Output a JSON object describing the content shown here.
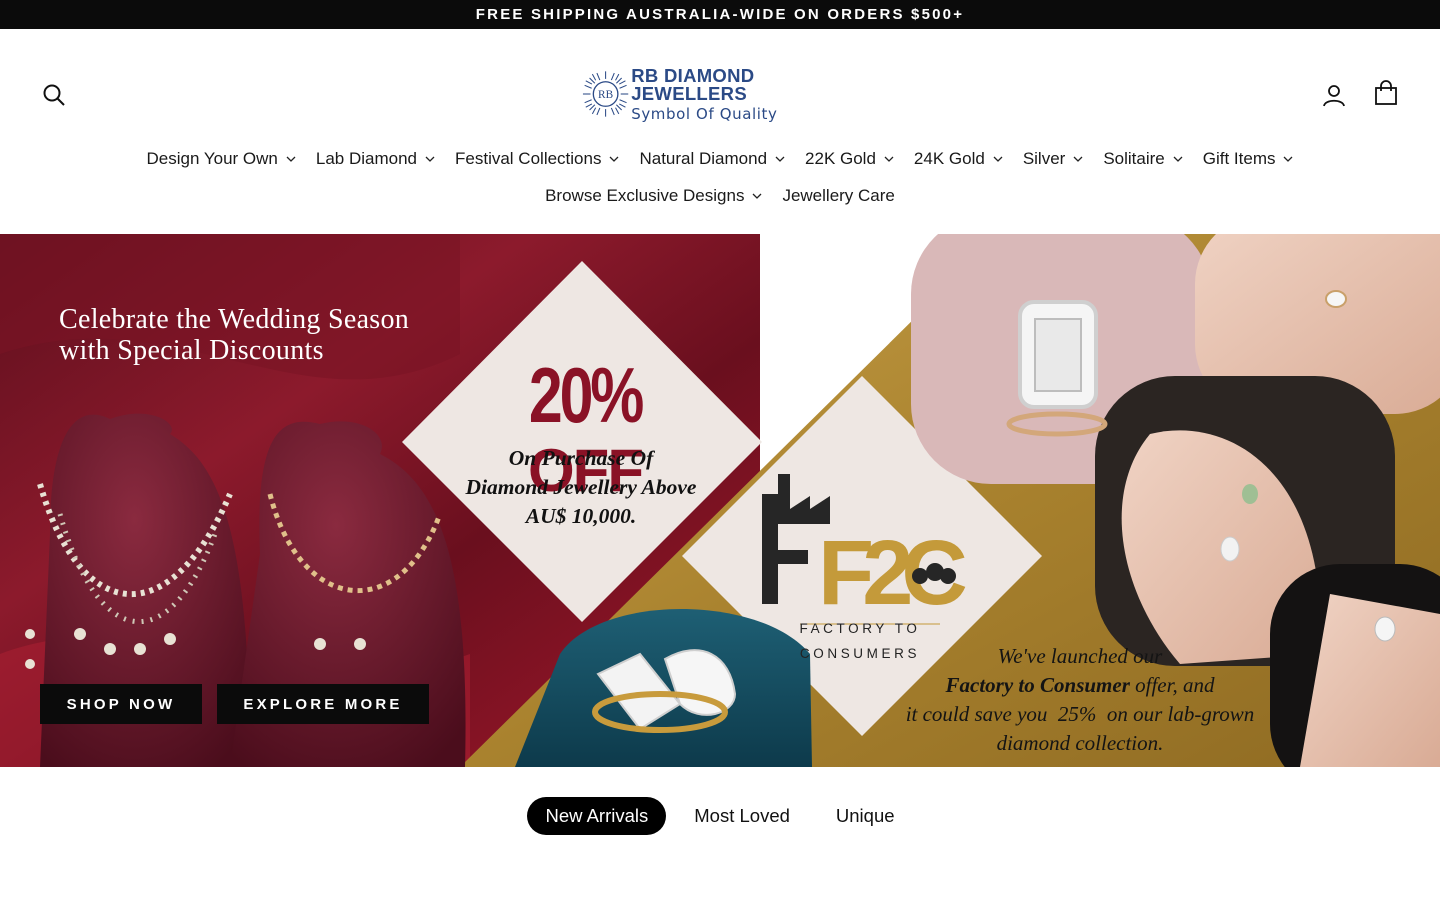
{
  "announcement": "FREE SHIPPING AUSTRALIA-WIDE ON ORDERS $500+",
  "header": {
    "logo_initials": "RB",
    "logo_name": "RB DIAMOND JEWELLERS",
    "logo_tagline": "Symbol Of Quality",
    "icons": [
      "search-icon",
      "account-icon",
      "cart-icon"
    ]
  },
  "nav": {
    "row1": [
      {
        "label": "Design Your Own",
        "has_dropdown": true
      },
      {
        "label": "Lab Diamond",
        "has_dropdown": true
      },
      {
        "label": "Festival Collections",
        "has_dropdown": true
      },
      {
        "label": "Natural Diamond",
        "has_dropdown": true
      },
      {
        "label": "22K Gold",
        "has_dropdown": true
      },
      {
        "label": "24K Gold",
        "has_dropdown": true
      },
      {
        "label": "Silver",
        "has_dropdown": true
      },
      {
        "label": "Solitaire",
        "has_dropdown": true
      },
      {
        "label": "Gift Items",
        "has_dropdown": true
      }
    ],
    "row2": [
      {
        "label": "Browse Exclusive Designs",
        "has_dropdown": true
      },
      {
        "label": "Jewellery Care",
        "has_dropdown": false
      }
    ]
  },
  "hero": {
    "heading_line1": "Celebrate the Wedding Season",
    "heading_line2": "with Special Discounts",
    "promo_percent": "20%",
    "promo_off": "OFF",
    "promo_line1": "On Purchase Of",
    "promo_line2": "Diamond Jewellery Above",
    "promo_line3": "AU$ 10,000.",
    "f2c_mark": "F2C",
    "f2c_caption_line1": "FACTORY TO",
    "f2c_caption_line2": "CONSUMERS",
    "offer_line1": "We've launched our",
    "offer_line2_bold": "Factory to Consumer",
    "offer_line2_rest": " offer, and",
    "offer_line3": "it could save you  25%  on our lab-grown",
    "offer_line4": "diamond collection.",
    "btn_shop": "SHOP NOW",
    "btn_explore": "EXPLORE MORE",
    "colors": {
      "maroon": "#7a1424",
      "gold": "#b38a33",
      "cream": "#eee7e3",
      "promo_red": "#8a1226"
    }
  },
  "tabs": [
    {
      "label": "New Arrivals",
      "active": true
    },
    {
      "label": "Most Loved",
      "active": false
    },
    {
      "label": "Unique",
      "active": false
    }
  ]
}
